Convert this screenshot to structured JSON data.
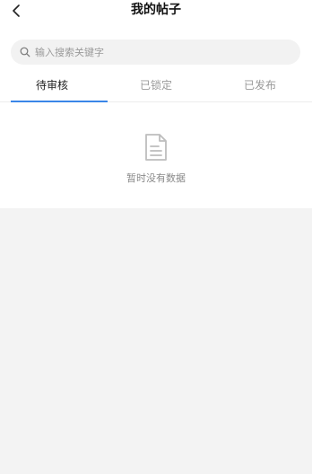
{
  "header": {
    "title": "我的帖子"
  },
  "search": {
    "placeholder": "输入搜索关键字",
    "value": ""
  },
  "tabs": [
    {
      "label": "待审核",
      "active": true
    },
    {
      "label": "已锁定",
      "active": false
    },
    {
      "label": "已发布",
      "active": false
    }
  ],
  "empty_state": {
    "text": "暂时没有数据",
    "icon": "document-icon"
  },
  "colors": {
    "accent": "#3a86e8",
    "background": "#f3f3f3",
    "surface": "#ffffff"
  }
}
